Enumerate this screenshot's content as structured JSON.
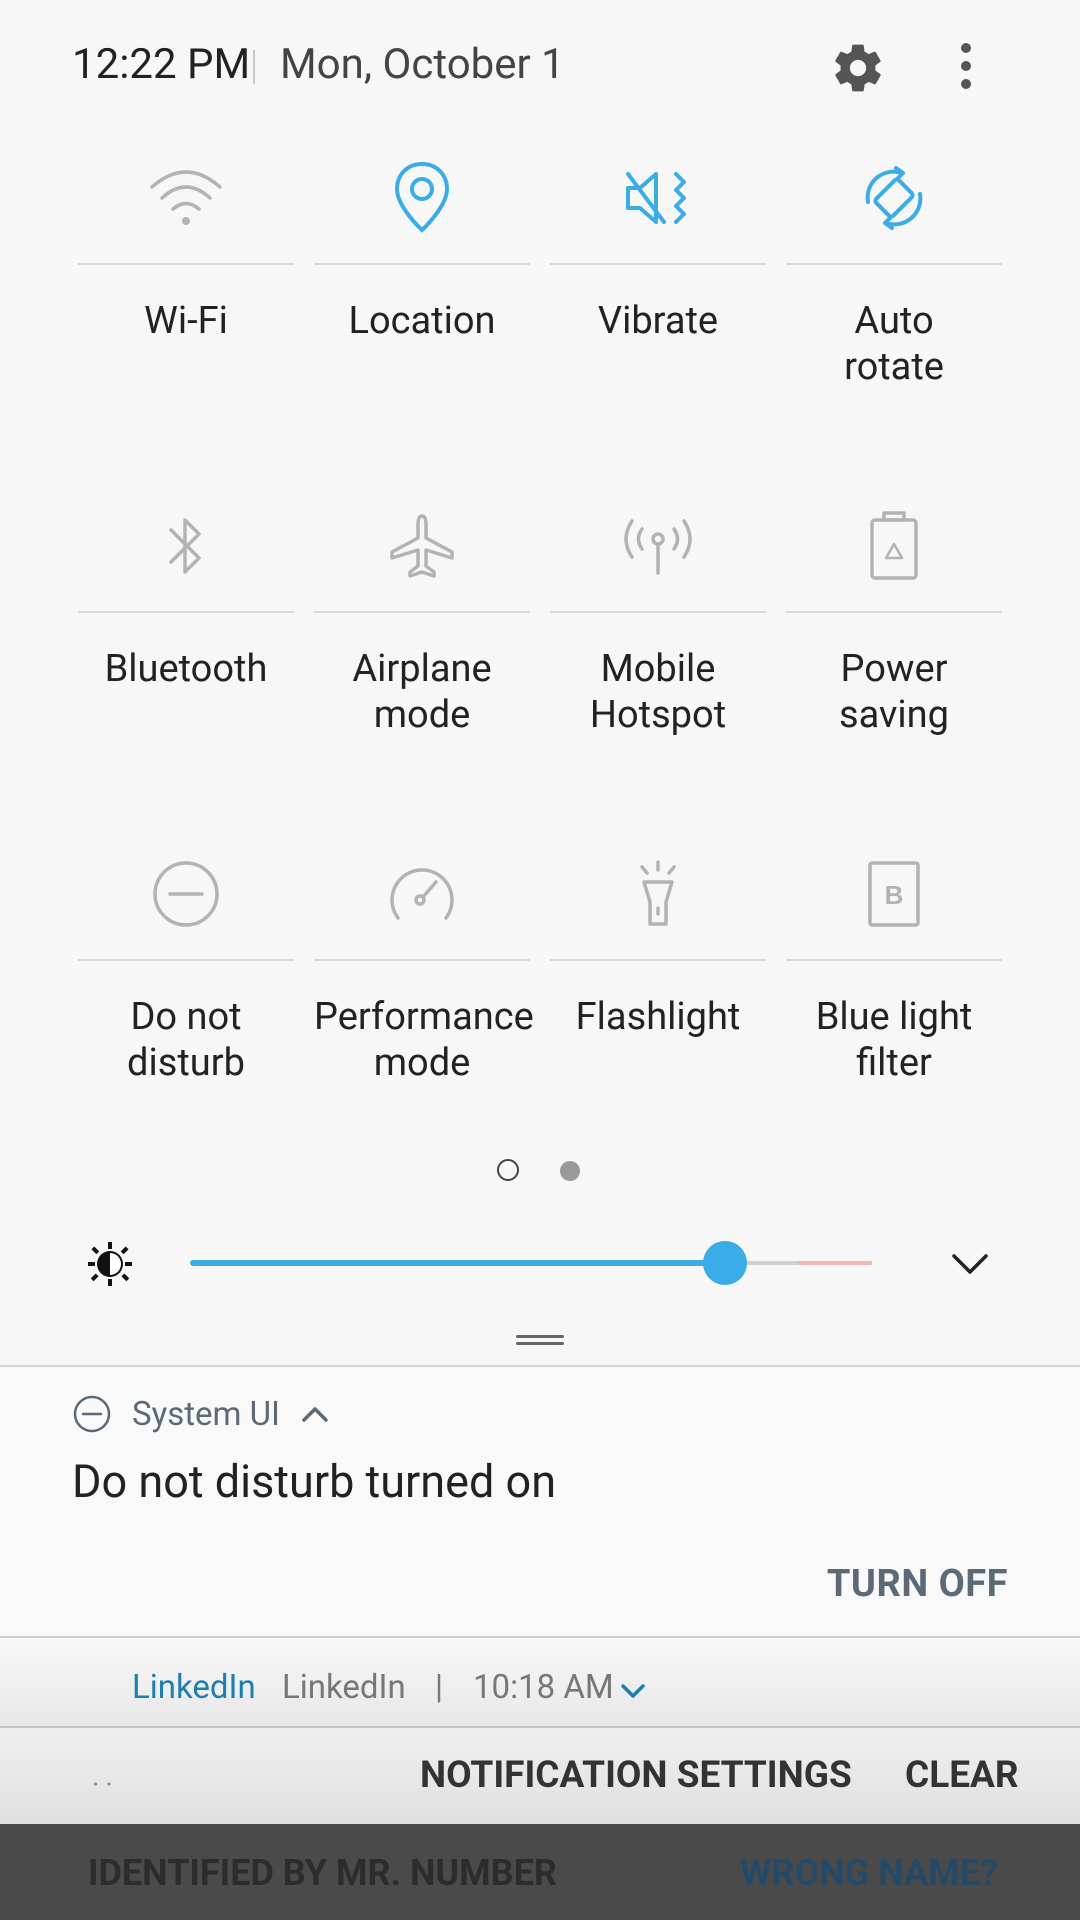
{
  "header": {
    "time": "12:22 PM",
    "date": "Mon, October 1",
    "settings_icon": "gear-icon",
    "more_icon": "more-vertical-icon"
  },
  "tiles": [
    {
      "label": "Wi-Fi",
      "icon": "wifi-icon",
      "active": false
    },
    {
      "label": "Location",
      "icon": "location-pin-icon",
      "active": true
    },
    {
      "label": "Vibrate",
      "icon": "vibrate-icon",
      "active": true
    },
    {
      "label": "Auto\nrotate",
      "icon": "auto-rotate-icon",
      "active": true
    },
    {
      "label": "Bluetooth",
      "icon": "bluetooth-icon",
      "active": false
    },
    {
      "label": "Airplane\nmode",
      "icon": "airplane-icon",
      "active": false
    },
    {
      "label": "Mobile\nHotspot",
      "icon": "hotspot-icon",
      "active": false
    },
    {
      "label": "Power\nsaving",
      "icon": "battery-recycle-icon",
      "active": false
    },
    {
      "label": "Do not\ndisturb",
      "icon": "do-not-disturb-icon",
      "active": false
    },
    {
      "label": "Performance\nmode",
      "icon": "speedometer-icon",
      "active": false
    },
    {
      "label": "Flashlight",
      "icon": "flashlight-icon",
      "active": false
    },
    {
      "label": "Blue light\nfilter",
      "icon": "blue-light-filter-icon",
      "active": false
    }
  ],
  "pager": {
    "pages": 2,
    "current": 1
  },
  "brightness": {
    "level": 0.78,
    "icon": "brightness-icon"
  },
  "notification": {
    "app_name": "System UI",
    "title": "Do not disturb turned on",
    "action": "TURN OFF"
  },
  "linkedin": {
    "app": "LinkedIn",
    "name": "LinkedIn",
    "separator": "|",
    "time": "10:18 AM"
  },
  "bottom_bar": {
    "dots": "··",
    "settings": "NOTIFICATION SETTINGS",
    "clear": "CLEAR"
  },
  "behind": {
    "left": "IDENTIFIED BY MR. NUMBER",
    "right": "WRONG NAME?"
  },
  "colors": {
    "accent": "#3aace6",
    "inactive_icon": "#9e9e9e",
    "secondary_text": "#5c6a78"
  }
}
